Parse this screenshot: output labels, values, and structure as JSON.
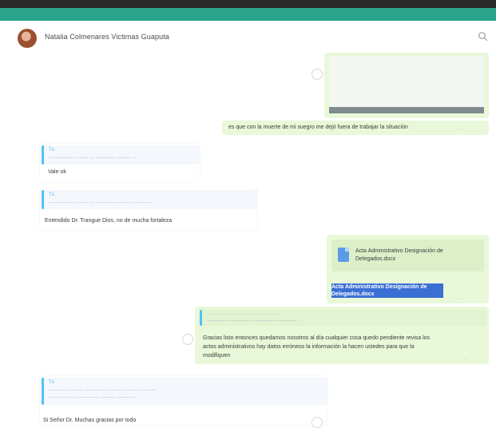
{
  "header": {
    "contact_name": "Natalia Colmenares Victimas Guaputa"
  },
  "messages": [
    {
      "id": "img-msg",
      "direction": "out",
      "type": "image"
    },
    {
      "id": "m1",
      "direction": "out",
      "text": "es que con la muerte de mi suegro me dejó fuera de trabajar la situación"
    },
    {
      "id": "m2",
      "direction": "in",
      "quote_name": "Tú",
      "text": "Vale ok"
    },
    {
      "id": "m3",
      "direction": "in",
      "quote_name": "Tú",
      "text": "Entendido Dr. Trangue Dios, no de mucha fortaleza"
    },
    {
      "id": "m4",
      "direction": "out",
      "type": "document",
      "doc_title": "Acta Administrativo Designación de Delegados.docx",
      "selected_text": "Acta Administrativo Designación de Delegados.docx"
    },
    {
      "id": "m5",
      "direction": "out",
      "text_line1": "Gracias listo entonces quedamos nosotros al día cualquier cosa quedo pendiente revisa los",
      "text_line2": "actos administrativos hay datos erróneos la información la hacen ustedes para que la",
      "text_line3": "modifiquen"
    },
    {
      "id": "m6",
      "direction": "in",
      "quote_name": "Tú",
      "text": "Si Señor Dr. Muchas gracias por todo"
    }
  ],
  "colors": {
    "accent": "#2aa38b",
    "outgoing_bubble": "#e8f8d9",
    "quote_bar": "#4fc3f7",
    "selection": "#3a6fd4"
  },
  "icons": {
    "search": "search-icon",
    "avatar": "avatar",
    "document": "document-icon"
  }
}
